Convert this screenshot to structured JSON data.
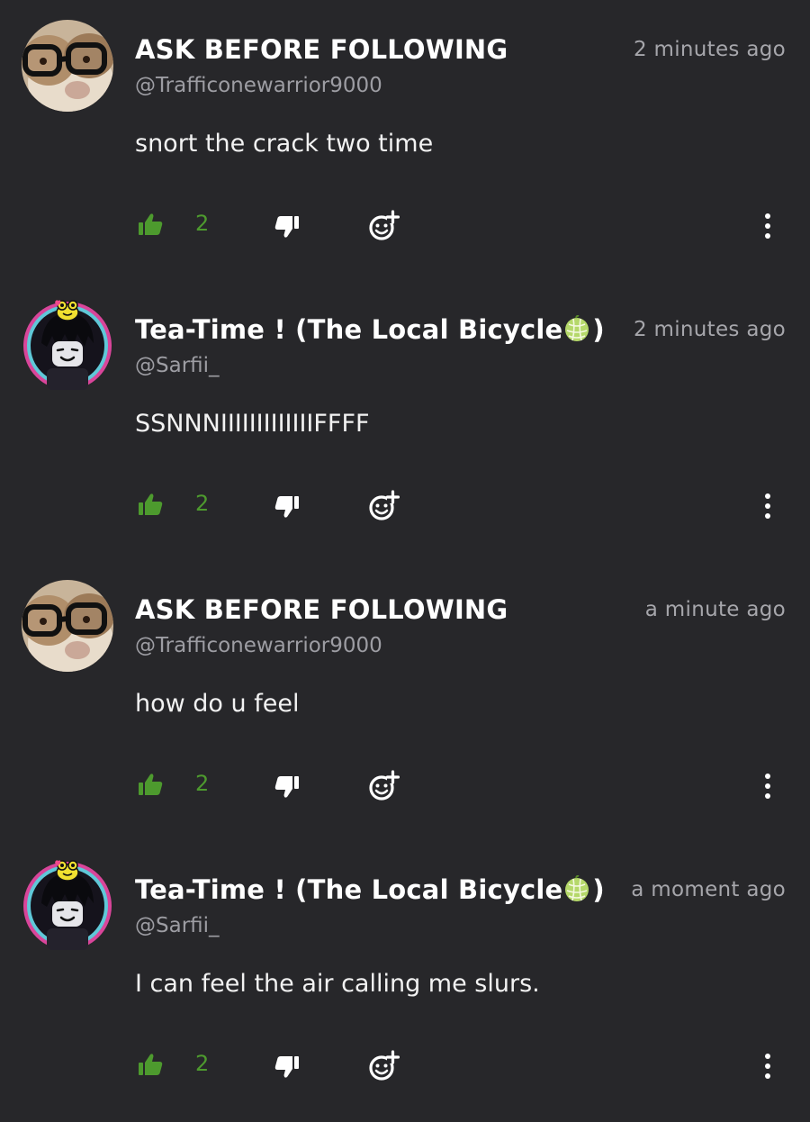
{
  "colors": {
    "background": "#27272a",
    "like_green": "#4d9a2e",
    "secondary_text": "#9d9da3",
    "avatar_ring_outer": "#d9459a",
    "avatar_ring_inner": "#5fc8d8"
  },
  "icons": {
    "like": "thumbs-up-icon",
    "dislike": "thumbs-down-icon",
    "react": "add-reaction-icon",
    "more": "more-vertical-icon",
    "melon": "melon-emoji-icon"
  },
  "comments": [
    {
      "display_name": "ASK BEFORE FOLLOWING",
      "name_suffix": "",
      "handle": "@Trafficonewarrior9000",
      "time": "2 minutes ago",
      "text": "snort the crack two time",
      "likes": "2",
      "avatar": "hamster-with-glasses"
    },
    {
      "display_name": "Tea-Time ! (The Local Bicycle",
      "name_suffix": ")",
      "handle": "@Sarfii_",
      "time": "2 minutes ago",
      "text": "SSNNNIIIIIIIIIIIIIFFFF",
      "likes": "2",
      "avatar": "roblox-character-with-frog"
    },
    {
      "display_name": "ASK BEFORE FOLLOWING",
      "name_suffix": "",
      "handle": "@Trafficonewarrior9000",
      "time": "a minute ago",
      "text": "how do u feel",
      "likes": "2",
      "avatar": "hamster-with-glasses"
    },
    {
      "display_name": "Tea-Time ! (The Local Bicycle",
      "name_suffix": ")",
      "handle": "@Sarfii_",
      "time": "a moment ago",
      "text": "I can feel the air calling me slurs.",
      "likes": "2",
      "avatar": "roblox-character-with-frog"
    }
  ]
}
